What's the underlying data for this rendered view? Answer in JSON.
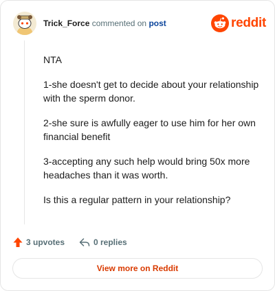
{
  "comment": {
    "username": "Trick_Force",
    "action_text": "commented on",
    "post_link_label": "post",
    "paragraphs": [
      "NTA",
      "1-she doesn't get to decide about your relationship with the sperm donor.",
      "2-she sure is awfully eager to use him for her own financial benefit",
      "3-accepting any such help would bring 50x more headaches than it was worth.",
      "Is this a regular pattern in your relationship?"
    ],
    "upvotes_label": "3 upvotes",
    "replies_label": "0 replies"
  },
  "brand": {
    "wordmark": "reddit",
    "color": "#ff4500"
  },
  "footer": {
    "view_more_label": "View more on Reddit"
  },
  "icons": {
    "avatar": "snoo-avatar-icon",
    "logo": "reddit-logo-icon",
    "upvote": "upvote-arrow-icon",
    "reply": "reply-arrow-icon"
  },
  "colors": {
    "username": "#1c1c1c",
    "post_link": "#0a449b",
    "meta": "#576f76",
    "upvote_arrow": "#ff4500",
    "button_text": "#d93a00"
  }
}
